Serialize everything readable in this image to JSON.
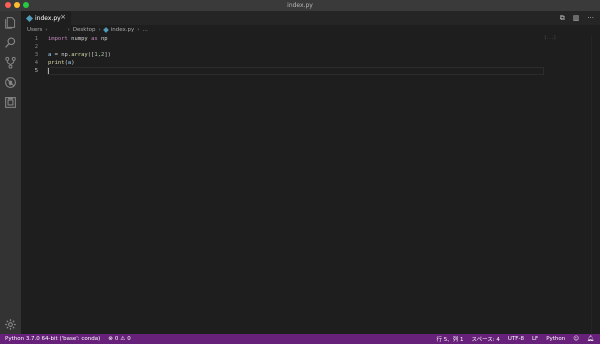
{
  "window": {
    "title": "index.py"
  },
  "tab": {
    "label": "index.py",
    "close": "×"
  },
  "tab_actions": {
    "compare": "⧉",
    "split": "▥",
    "more": "···"
  },
  "breadcrumb": {
    "items": [
      "Users",
      "Desktop",
      "index.py",
      "…"
    ],
    "sep": "›"
  },
  "editor": {
    "lines": [
      {
        "n": "1",
        "tokens": [
          {
            "t": "import",
            "c": "kw"
          },
          {
            "t": " numpy ",
            "c": ""
          },
          {
            "t": "as",
            "c": "kw"
          },
          {
            "t": " np",
            "c": ""
          }
        ]
      },
      {
        "n": "2",
        "tokens": []
      },
      {
        "n": "3",
        "tokens": [
          {
            "t": "a",
            "c": "var"
          },
          {
            "t": " = np.",
            "c": ""
          },
          {
            "t": "array",
            "c": "fn"
          },
          {
            "t": "([",
            "c": ""
          },
          {
            "t": "1",
            "c": "num"
          },
          {
            "t": ",",
            "c": ""
          },
          {
            "t": "2",
            "c": "num"
          },
          {
            "t": "])",
            "c": ""
          }
        ]
      },
      {
        "n": "4",
        "tokens": [
          {
            "t": "print",
            "c": "fn"
          },
          {
            "t": "(",
            "c": ""
          },
          {
            "t": "a",
            "c": "var"
          },
          {
            "t": ")",
            "c": ""
          }
        ]
      },
      {
        "n": "5",
        "tokens": []
      }
    ],
    "current_line": 5,
    "minimap_text": "[...]"
  },
  "statusbar": {
    "interpreter": "Python 3.7.0 64-bit ('base': conda)",
    "errors": "0",
    "warnings": "0",
    "position": "行 5、列 1",
    "indent": "スペース: 4",
    "encoding": "UTF-8",
    "eol": "LF",
    "language": "Python",
    "background": "#68217a"
  },
  "icons": [
    "explorer-icon",
    "search-icon",
    "source-control-icon",
    "debug-icon",
    "extensions-icon",
    "settings-gear-icon",
    "smiley-icon",
    "bell-icon"
  ]
}
